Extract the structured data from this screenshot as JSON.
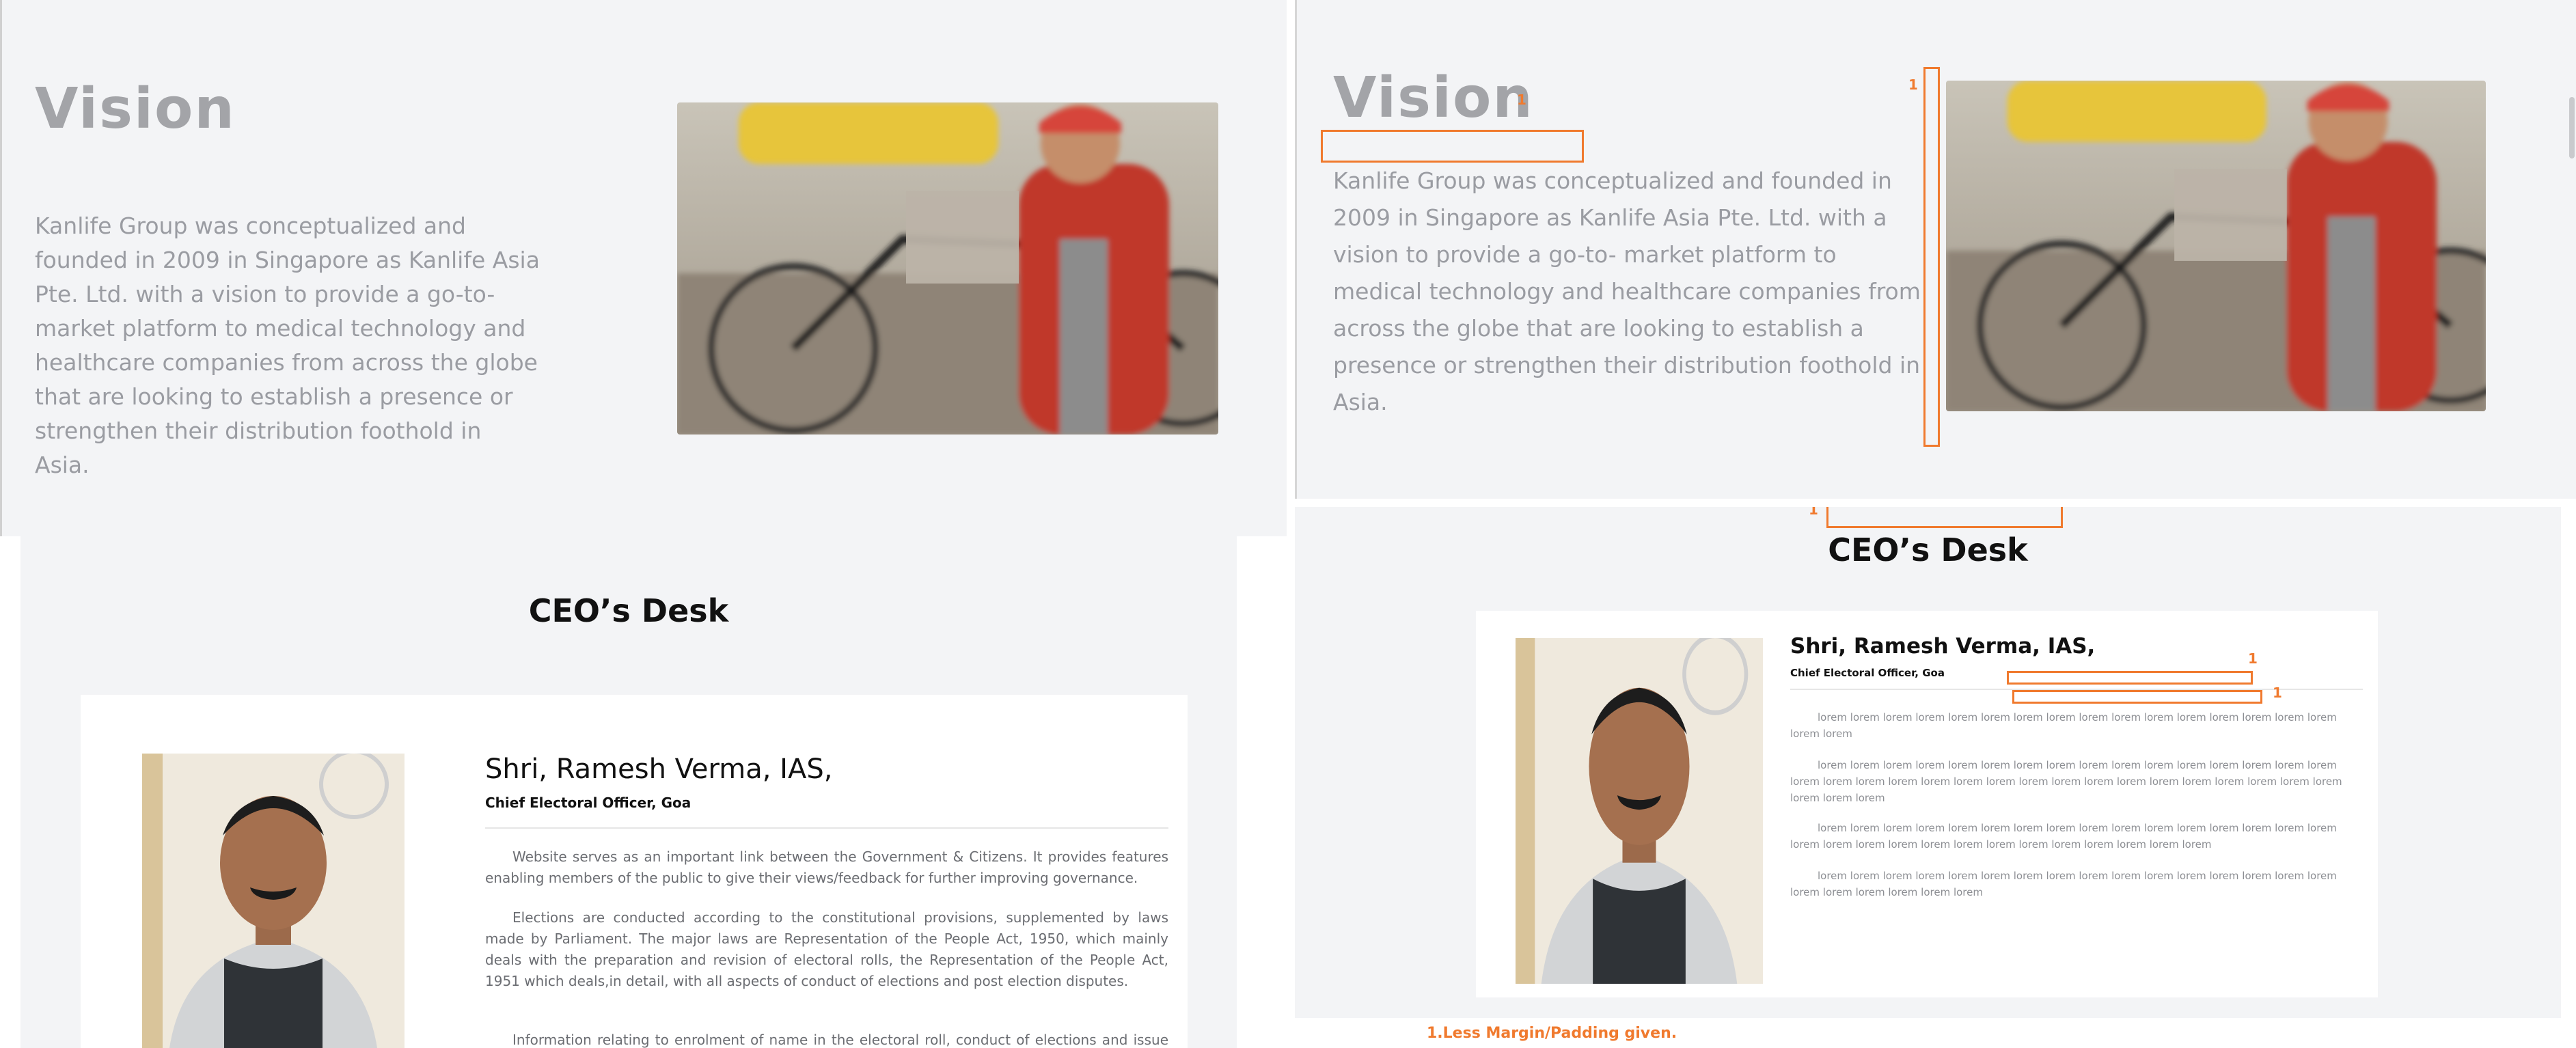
{
  "vision": {
    "title": "Vision",
    "text": "Kanlife Group was conceptualized and founded in 2009 in Singapore as Kanlife Asia Pte. Ltd. with a vision to provide a go-to- market platform to medical technology and healthcare companies from across the globe that are looking to establish a presence or strengthen their distribution foothold in Asia."
  },
  "ceo": {
    "heading": "CEO’s Desk",
    "name": "Shri, Ramesh Verma, IAS,",
    "role": "Chief Electoral Officer, Goa",
    "paragraphs": [
      "Website serves as an important link between the Government & Citizens. It provides features enabling members of the public to give their views/feedback for further improving governance.",
      "Elections are conducted according to the constitutional provisions, supplemented by laws made by Parliament. The major laws are Representation of the People Act, 1950, which mainly deals with the preparation and revision of electoral rolls, the Representation of the People Act, 1951 which deals,in detail, with all aspects of conduct of elections and post election disputes.",
      "Information relating to enrolment of name in the electoral roll, conduct of elections and issue of"
    ],
    "lorem": [
      "lorem lorem lorem lorem lorem lorem lorem lorem lorem lorem lorem lorem lorem lorem lorem lorem lorem lorem",
      "lorem lorem lorem lorem lorem lorem lorem lorem lorem lorem lorem lorem lorem lorem lorem lorem lorem lorem lorem lorem lorem lorem lorem lorem lorem lorem lorem lorem lorem lorem lorem lorem lorem lorem lorem lorem",
      "lorem lorem lorem lorem lorem lorem lorem lorem lorem lorem lorem lorem lorem lorem lorem lorem lorem lorem lorem lorem lorem lorem lorem lorem lorem lorem lorem lorem lorem",
      "lorem lorem lorem lorem lorem lorem lorem lorem lorem lorem lorem lorem lorem lorem lorem lorem lorem lorem lorem lorem lorem lorem"
    ]
  },
  "annotations": {
    "marker_label": "1",
    "note": "1.Less Margin/Padding given."
  },
  "colors": {
    "panel_bg": "#f3f4f6",
    "annotation": "#f07a2e",
    "vision_text": "#9a9ca2"
  }
}
